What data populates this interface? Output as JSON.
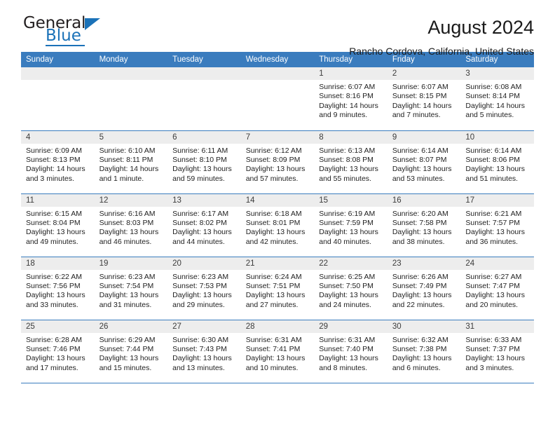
{
  "brand": {
    "name_top": "General",
    "name_bottom": "Blue",
    "logo_icon": "triangle-icon",
    "accent_color": "#1b72b8"
  },
  "header": {
    "title": "August 2024",
    "subtitle": "Rancho Cordova, California, United States"
  },
  "theme": {
    "header_row_color": "#3a7cbe",
    "day_band_color": "#ededed",
    "divider_color": "#3a7cbe"
  },
  "weekday_headers": [
    "Sunday",
    "Monday",
    "Tuesday",
    "Wednesday",
    "Thursday",
    "Friday",
    "Saturday"
  ],
  "weeks": [
    [
      {
        "day": "",
        "lines": []
      },
      {
        "day": "",
        "lines": []
      },
      {
        "day": "",
        "lines": []
      },
      {
        "day": "",
        "lines": []
      },
      {
        "day": "1",
        "lines": [
          "Sunrise: 6:07 AM",
          "Sunset: 8:16 PM",
          "Daylight: 14 hours",
          "and 9 minutes."
        ]
      },
      {
        "day": "2",
        "lines": [
          "Sunrise: 6:07 AM",
          "Sunset: 8:15 PM",
          "Daylight: 14 hours",
          "and 7 minutes."
        ]
      },
      {
        "day": "3",
        "lines": [
          "Sunrise: 6:08 AM",
          "Sunset: 8:14 PM",
          "Daylight: 14 hours",
          "and 5 minutes."
        ]
      }
    ],
    [
      {
        "day": "4",
        "lines": [
          "Sunrise: 6:09 AM",
          "Sunset: 8:13 PM",
          "Daylight: 14 hours",
          "and 3 minutes."
        ]
      },
      {
        "day": "5",
        "lines": [
          "Sunrise: 6:10 AM",
          "Sunset: 8:11 PM",
          "Daylight: 14 hours",
          "and 1 minute."
        ]
      },
      {
        "day": "6",
        "lines": [
          "Sunrise: 6:11 AM",
          "Sunset: 8:10 PM",
          "Daylight: 13 hours",
          "and 59 minutes."
        ]
      },
      {
        "day": "7",
        "lines": [
          "Sunrise: 6:12 AM",
          "Sunset: 8:09 PM",
          "Daylight: 13 hours",
          "and 57 minutes."
        ]
      },
      {
        "day": "8",
        "lines": [
          "Sunrise: 6:13 AM",
          "Sunset: 8:08 PM",
          "Daylight: 13 hours",
          "and 55 minutes."
        ]
      },
      {
        "day": "9",
        "lines": [
          "Sunrise: 6:14 AM",
          "Sunset: 8:07 PM",
          "Daylight: 13 hours",
          "and 53 minutes."
        ]
      },
      {
        "day": "10",
        "lines": [
          "Sunrise: 6:14 AM",
          "Sunset: 8:06 PM",
          "Daylight: 13 hours",
          "and 51 minutes."
        ]
      }
    ],
    [
      {
        "day": "11",
        "lines": [
          "Sunrise: 6:15 AM",
          "Sunset: 8:04 PM",
          "Daylight: 13 hours",
          "and 49 minutes."
        ]
      },
      {
        "day": "12",
        "lines": [
          "Sunrise: 6:16 AM",
          "Sunset: 8:03 PM",
          "Daylight: 13 hours",
          "and 46 minutes."
        ]
      },
      {
        "day": "13",
        "lines": [
          "Sunrise: 6:17 AM",
          "Sunset: 8:02 PM",
          "Daylight: 13 hours",
          "and 44 minutes."
        ]
      },
      {
        "day": "14",
        "lines": [
          "Sunrise: 6:18 AM",
          "Sunset: 8:01 PM",
          "Daylight: 13 hours",
          "and 42 minutes."
        ]
      },
      {
        "day": "15",
        "lines": [
          "Sunrise: 6:19 AM",
          "Sunset: 7:59 PM",
          "Daylight: 13 hours",
          "and 40 minutes."
        ]
      },
      {
        "day": "16",
        "lines": [
          "Sunrise: 6:20 AM",
          "Sunset: 7:58 PM",
          "Daylight: 13 hours",
          "and 38 minutes."
        ]
      },
      {
        "day": "17",
        "lines": [
          "Sunrise: 6:21 AM",
          "Sunset: 7:57 PM",
          "Daylight: 13 hours",
          "and 36 minutes."
        ]
      }
    ],
    [
      {
        "day": "18",
        "lines": [
          "Sunrise: 6:22 AM",
          "Sunset: 7:56 PM",
          "Daylight: 13 hours",
          "and 33 minutes."
        ]
      },
      {
        "day": "19",
        "lines": [
          "Sunrise: 6:23 AM",
          "Sunset: 7:54 PM",
          "Daylight: 13 hours",
          "and 31 minutes."
        ]
      },
      {
        "day": "20",
        "lines": [
          "Sunrise: 6:23 AM",
          "Sunset: 7:53 PM",
          "Daylight: 13 hours",
          "and 29 minutes."
        ]
      },
      {
        "day": "21",
        "lines": [
          "Sunrise: 6:24 AM",
          "Sunset: 7:51 PM",
          "Daylight: 13 hours",
          "and 27 minutes."
        ]
      },
      {
        "day": "22",
        "lines": [
          "Sunrise: 6:25 AM",
          "Sunset: 7:50 PM",
          "Daylight: 13 hours",
          "and 24 minutes."
        ]
      },
      {
        "day": "23",
        "lines": [
          "Sunrise: 6:26 AM",
          "Sunset: 7:49 PM",
          "Daylight: 13 hours",
          "and 22 minutes."
        ]
      },
      {
        "day": "24",
        "lines": [
          "Sunrise: 6:27 AM",
          "Sunset: 7:47 PM",
          "Daylight: 13 hours",
          "and 20 minutes."
        ]
      }
    ],
    [
      {
        "day": "25",
        "lines": [
          "Sunrise: 6:28 AM",
          "Sunset: 7:46 PM",
          "Daylight: 13 hours",
          "and 17 minutes."
        ]
      },
      {
        "day": "26",
        "lines": [
          "Sunrise: 6:29 AM",
          "Sunset: 7:44 PM",
          "Daylight: 13 hours",
          "and 15 minutes."
        ]
      },
      {
        "day": "27",
        "lines": [
          "Sunrise: 6:30 AM",
          "Sunset: 7:43 PM",
          "Daylight: 13 hours",
          "and 13 minutes."
        ]
      },
      {
        "day": "28",
        "lines": [
          "Sunrise: 6:31 AM",
          "Sunset: 7:41 PM",
          "Daylight: 13 hours",
          "and 10 minutes."
        ]
      },
      {
        "day": "29",
        "lines": [
          "Sunrise: 6:31 AM",
          "Sunset: 7:40 PM",
          "Daylight: 13 hours",
          "and 8 minutes."
        ]
      },
      {
        "day": "30",
        "lines": [
          "Sunrise: 6:32 AM",
          "Sunset: 7:38 PM",
          "Daylight: 13 hours",
          "and 6 minutes."
        ]
      },
      {
        "day": "31",
        "lines": [
          "Sunrise: 6:33 AM",
          "Sunset: 7:37 PM",
          "Daylight: 13 hours",
          "and 3 minutes."
        ]
      }
    ]
  ]
}
